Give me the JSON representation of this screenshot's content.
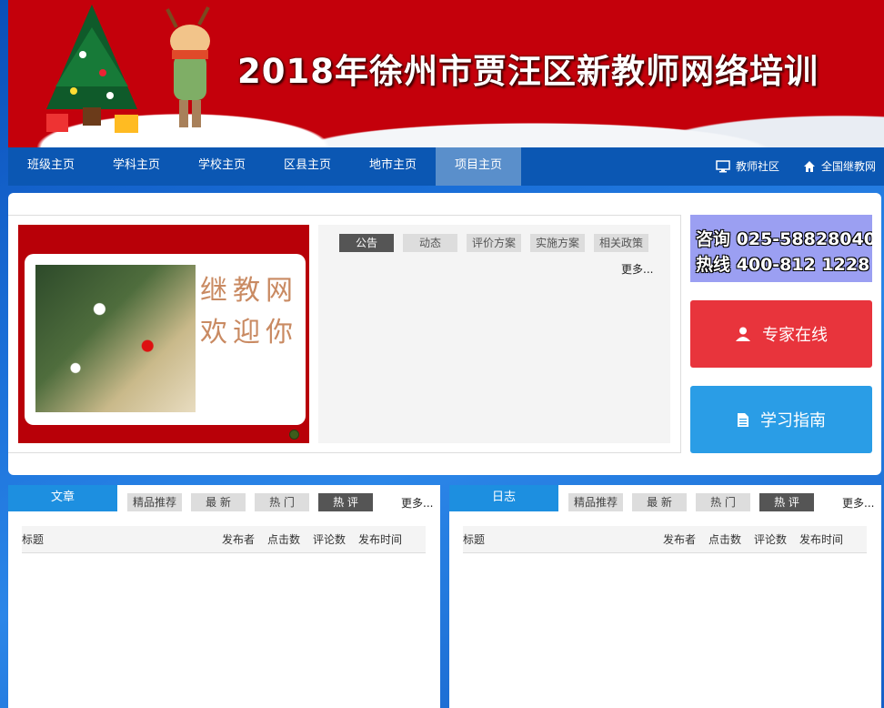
{
  "banner": {
    "title": "2018年徐州市贾汪区新教师网络培训"
  },
  "nav": {
    "items": [
      {
        "label": "班级主页"
      },
      {
        "label": "学科主页"
      },
      {
        "label": "学校主页"
      },
      {
        "label": "区县主页"
      },
      {
        "label": "地市主页"
      },
      {
        "label": "项目主页"
      }
    ],
    "active_index": 5,
    "community": "教师社区",
    "national": "全国继教网"
  },
  "slider": {
    "welcome_text": "继教网 欢迎你"
  },
  "notice": {
    "tabs": [
      "公告",
      "动态",
      "评价方案",
      "实施方案",
      "相关政策"
    ],
    "active_tab": "公告",
    "more": "更多..."
  },
  "hotline": {
    "consult_label": "咨询",
    "consult_number": "025-58828040",
    "hotline_label": "热线",
    "hotline_number": "400-812 1228"
  },
  "buttons": {
    "expert": "专家在线",
    "guide": "学习指南"
  },
  "colors": {
    "nav_bg": "#0b57b3",
    "banner_red": "#c4000b",
    "expert_red": "#e8343c",
    "guide_blue": "#2a9de6",
    "title_blue": "#1d8fe0"
  },
  "articles": {
    "title": "文章",
    "tabs": [
      "精品推荐",
      "最 新",
      "热 门",
      "热 评"
    ],
    "active_tab": "热 评",
    "more": "更多...",
    "columns": [
      "标题",
      "发布者",
      "点击数",
      "评论数",
      "发布时间"
    ]
  },
  "logs": {
    "title": "日志",
    "tabs": [
      "精品推荐",
      "最 新",
      "热 门",
      "热 评"
    ],
    "active_tab": "热 评",
    "more": "更多...",
    "columns": [
      "标题",
      "发布者",
      "点击数",
      "评论数",
      "发布时间"
    ]
  }
}
